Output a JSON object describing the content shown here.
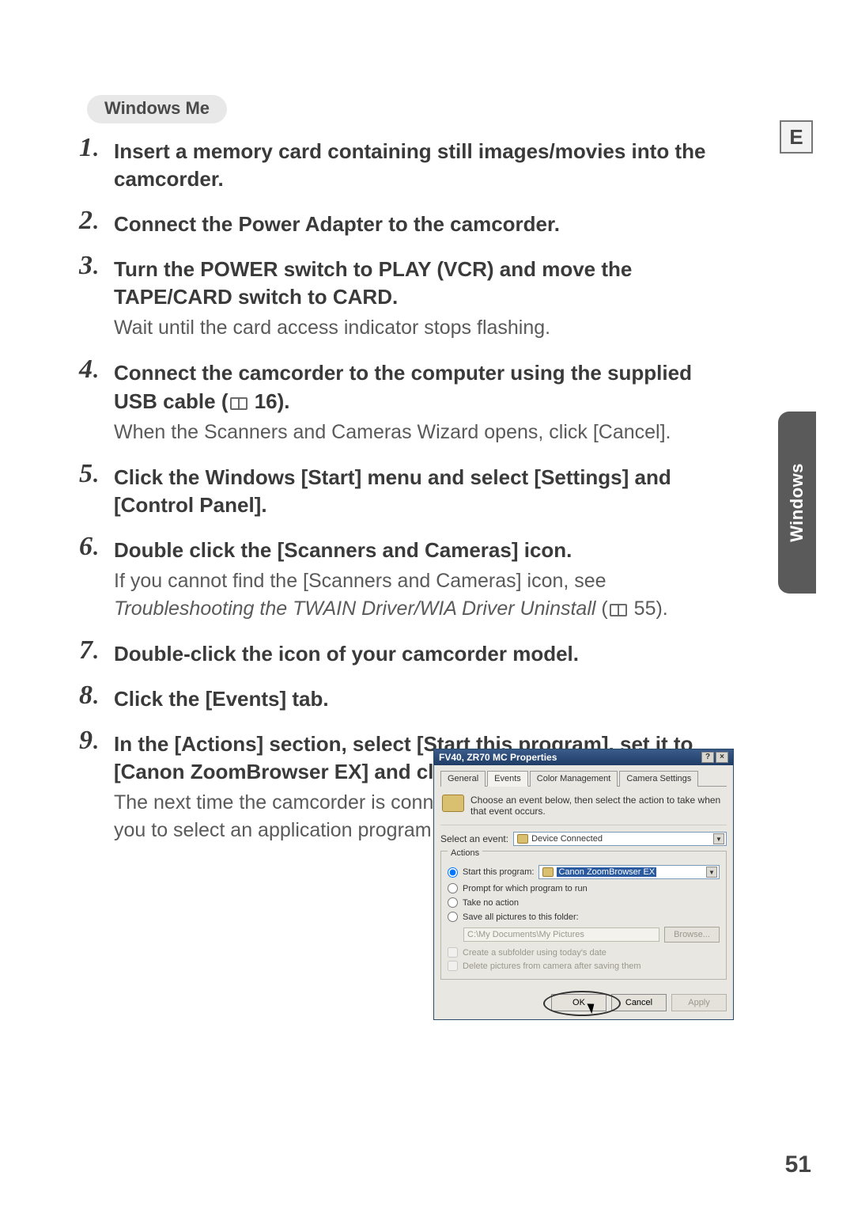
{
  "os_badge": "Windows Me",
  "side_tab": "Windows",
  "e_label": "E",
  "page_number": "51",
  "steps": [
    {
      "num": "1",
      "title": "Insert a memory card containing still images/movies into the camcorder."
    },
    {
      "num": "2",
      "title": "Connect the Power Adapter to the camcorder."
    },
    {
      "num": "3",
      "title": "Turn the POWER switch to PLAY (VCR) and move the TAPE/CARD switch to CARD.",
      "body": "Wait until the card access indicator stops flashing."
    },
    {
      "num": "4",
      "title_a": "Connect the camcorder to the computer using the supplied USB cable (",
      "title_b": " 16).",
      "body": "When the Scanners and Cameras Wizard opens, click [Cancel]."
    },
    {
      "num": "5",
      "title": "Click the Windows [Start] menu and select [Settings] and [Control Panel]."
    },
    {
      "num": "6",
      "title": "Double click the [Scanners and Cameras] icon.",
      "body_a": "If you cannot find the [Scanners and Cameras] icon, see ",
      "body_ital": "Troubleshooting the TWAIN Driver/WIA Driver Uninstall",
      "body_b": " (",
      "body_c": " 55)."
    },
    {
      "num": "7",
      "title": "Double-click the icon of your camcorder model."
    },
    {
      "num": "8",
      "title": "Click the [Events] tab."
    },
    {
      "num": "9",
      "title": "In the [Actions] section, select [Start this program], set it to [Canon ZoomBrowser EX] and click [OK].",
      "body": "The next time the camcorder is connected, a window appears allowing you to select an application program to start."
    }
  ],
  "dialog": {
    "title": "FV40, ZR70 MC Properties",
    "tabs": [
      "General",
      "Events",
      "Color Management",
      "Camera Settings"
    ],
    "active_tab": 1,
    "hint": "Choose an event below, then select the action to take when that event occurs.",
    "select_event_label": "Select an event:",
    "select_event_value": "Device Connected",
    "actions_legend": "Actions",
    "radios": {
      "start_program": "Start this program:",
      "start_program_value": "Canon ZoomBrowser EX",
      "prompt": "Prompt for which program to run",
      "take_no_action": "Take no action",
      "save_all": "Save all pictures to this folder:"
    },
    "path_value": "C:\\My Documents\\My Pictures",
    "browse_label": "Browse...",
    "chk_subfolder": "Create a subfolder using today's date",
    "chk_delete": "Delete pictures from camera after saving them",
    "buttons": {
      "ok": "OK",
      "cancel": "Cancel",
      "apply": "Apply"
    }
  }
}
